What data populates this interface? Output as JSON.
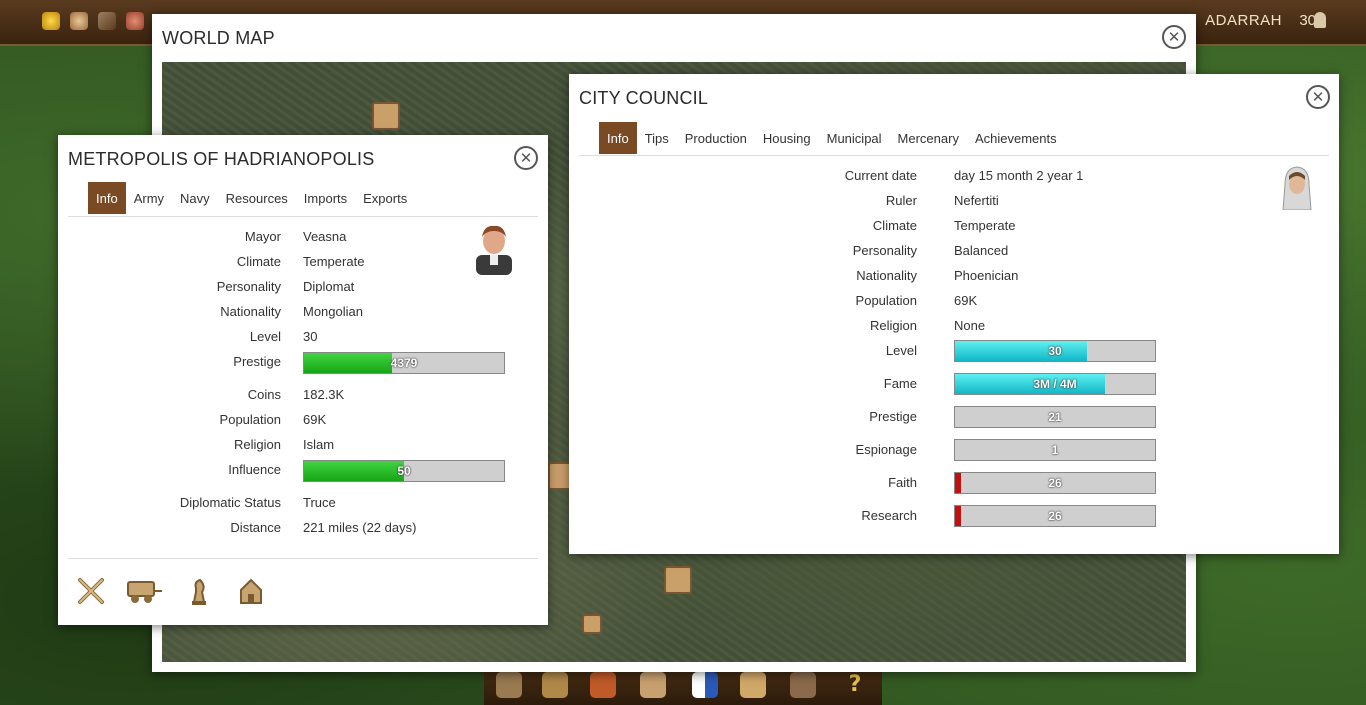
{
  "top_bar": {
    "player_name": "ADARRAH",
    "player_level": "30",
    "colors": {
      "bar_bg": "#4a2f16"
    }
  },
  "world_map": {
    "title": "WORLD MAP"
  },
  "metropolis": {
    "title": "METROPOLIS OF HADRIANOPOLIS",
    "tabs": [
      "Info",
      "Army",
      "Navy",
      "Resources",
      "Imports",
      "Exports"
    ],
    "active_tab": "Info",
    "fields": {
      "mayor": {
        "label": "Mayor",
        "value": "Veasna"
      },
      "climate": {
        "label": "Climate",
        "value": "Temperate"
      },
      "personality": {
        "label": "Personality",
        "value": "Diplomat"
      },
      "nationality": {
        "label": "Nationality",
        "value": "Mongolian"
      },
      "level": {
        "label": "Level",
        "value": "30"
      },
      "prestige": {
        "label": "Prestige",
        "value": "4379",
        "fill_fraction": 0.44
      },
      "coins": {
        "label": "Coins",
        "value": "182.3K"
      },
      "population": {
        "label": "Population",
        "value": "69K"
      },
      "religion": {
        "label": "Religion",
        "value": "Islam"
      },
      "influence": {
        "label": "Influence",
        "value": "50",
        "fill_fraction": 0.5
      },
      "diplomatic_status": {
        "label": "Diplomatic Status",
        "value": "Truce"
      },
      "distance": {
        "label": "Distance",
        "value": "221 miles (22 days)"
      }
    },
    "actions": [
      "attack-swords-icon",
      "caravan-wagon-icon",
      "spy-chess-icon",
      "embassy-house-icon"
    ]
  },
  "council": {
    "title": "CITY COUNCIL",
    "tabs": [
      "Info",
      "Tips",
      "Production",
      "Housing",
      "Municipal",
      "Mercenary",
      "Achievements"
    ],
    "active_tab": "Info",
    "fields": {
      "current_date": {
        "label": "Current date",
        "value": "day 15 month 2 year 1"
      },
      "ruler": {
        "label": "Ruler",
        "value": "Nefertiti"
      },
      "climate": {
        "label": "Climate",
        "value": "Temperate"
      },
      "personality": {
        "label": "Personality",
        "value": "Balanced"
      },
      "nationality": {
        "label": "Nationality",
        "value": "Phoenician"
      },
      "population": {
        "label": "Population",
        "value": "69K"
      },
      "religion": {
        "label": "Religion",
        "value": "None"
      }
    },
    "bars": [
      {
        "label": "Level",
        "value": "30",
        "fill_fraction": 0.66,
        "color": "cyan"
      },
      {
        "label": "Fame",
        "value": "3M / 4M",
        "fill_fraction": 0.75,
        "color": "cyan"
      },
      {
        "label": "Prestige",
        "value": "21",
        "fill_fraction": 0.0,
        "color": "cyan"
      },
      {
        "label": "Espionage",
        "value": "1",
        "fill_fraction": 0.0,
        "color": "cyan"
      },
      {
        "label": "Faith",
        "value": "26",
        "fill_fraction": 0.03,
        "color": "red"
      },
      {
        "label": "Research",
        "value": "26",
        "fill_fraction": 0.03,
        "color": "red"
      }
    ]
  }
}
